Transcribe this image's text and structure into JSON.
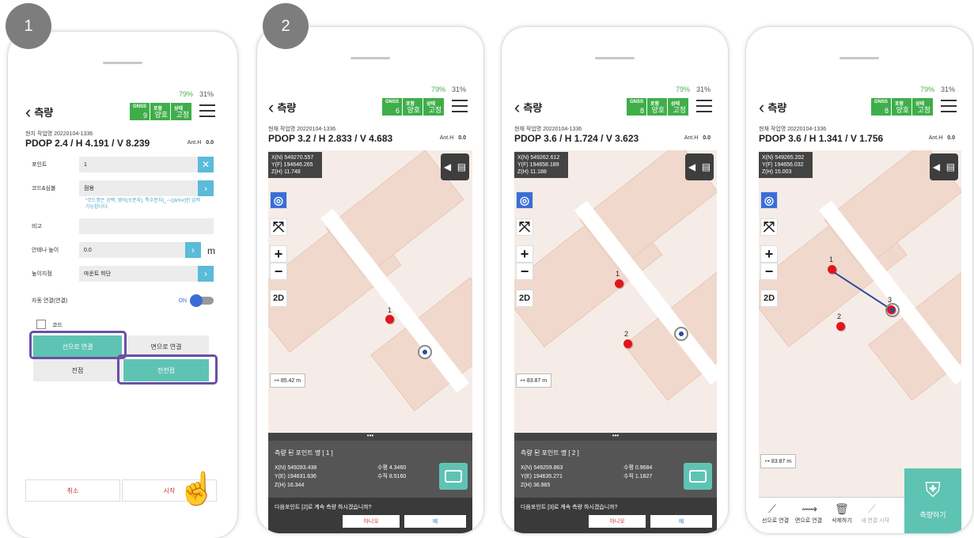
{
  "steps": [
    "1",
    "2"
  ],
  "status": {
    "signal": "79%",
    "battery": "31%"
  },
  "gnss": {
    "h1": "GNSS",
    "h2": "포함",
    "h3": "상태",
    "fix": "고정",
    "code": "양호"
  },
  "back": "측량",
  "p1": {
    "job": "현지 작업명 20220104-1336",
    "pdop": "PDOP 2.4 / H 4.191 / V 8.239",
    "anth": "Ant.H",
    "anthv": "0.0",
    "sat": "9",
    "point_label": "포인트",
    "point_val": "1",
    "code_label": "코드&심볼",
    "code_val": "점용",
    "hint": "*코드명은 공백, 영어(소문자), 특수문자(_-~()&%#)만 입력 가능합니다.",
    "note_label": "비고",
    "ant_label": "안테나 높이",
    "ant_val": "0.0",
    "ant_unit": "m",
    "hm_label": "높이지점",
    "hm_val": "마운트 하단",
    "auto_label": "자동 연결(연결)",
    "auto_val": "ON",
    "code_chk": "코드",
    "line_btn": "선으로 연결",
    "face_btn": "면으로 연결",
    "point_btn": "전점",
    "all_btn": "전전점",
    "cancel": "취소",
    "start": "시작"
  },
  "p2": {
    "job": "현재 작업명 20220104-1336",
    "pdop": "PDOP 3.2 / H 2.833 / V 4.683",
    "sat": "6",
    "x": "X(N) 549270.557",
    "y": "Y(F) 194646.265",
    "z": "Z(H) 11.748",
    "scale": "85.42 m",
    "pt1": "1",
    "title": "측량 된 포인트 명 [ 1 ]",
    "cx": "X(N) 549283.438",
    "cy": "Y(E) 194631.636",
    "cz": "Z(H) 16.344",
    "h": "수평 4.3460",
    "v": "수직 8.5160",
    "q": "다음포인트 [2]로 계속 측량 하시겠습니까?",
    "no": "아니오",
    "yes": "예"
  },
  "p3": {
    "job": "현재 작업명 20220104-1336",
    "pdop": "PDOP 3.6 / H 1.724 / V 3.623",
    "sat": "8",
    "x": "X(N) 549262.612",
    "y": "Y(F) 194658.189",
    "z": "Z(H) 11.188",
    "scale": "83.87 m",
    "pt1": "1",
    "pt2": "2",
    "title": "측량 된 포인트 명 [ 2 ]",
    "cx": "X(N) 549259.863",
    "cy": "Y(E) 194635.271",
    "cz": "Z(H) 36.985",
    "h": "수평 0.9684",
    "v": "수직 1.1827",
    "q": "다음포인트 [3]로 계속 측량 하시겠습니까?",
    "no": "아니오",
    "yes": "예"
  },
  "p4": {
    "job": "현재 작업명 20220104-1336",
    "pdop": "PDOP 3.6 / H 1.341 / V 1.756",
    "sat": "8",
    "x": "X(N) 549265.202",
    "y": "Y(F) 194656.032",
    "z": "Z(H) 15.003",
    "scale": "83.87 m",
    "pt1": "1",
    "pt2": "2",
    "pt3": "3",
    "b1": "선으로 연결",
    "b2": "면으로 연결",
    "b3": "삭제하기",
    "b4": "새 연결 시작",
    "measure": "측량하기"
  }
}
